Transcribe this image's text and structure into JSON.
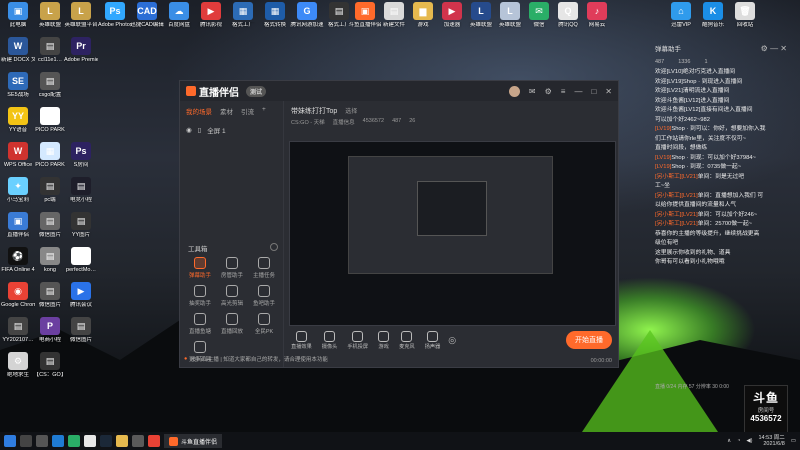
{
  "desktop_icons_left": [
    {
      "label": "此电脑",
      "color": "#3a8ee6",
      "glyph": "▣"
    },
    {
      "label": "英雄联盟",
      "color": "#c8a24a",
      "glyph": "L"
    },
    {
      "label": "新建 DOCX 文档",
      "color": "#2b579a",
      "glyph": "W"
    },
    {
      "label": "ccl11e1…",
      "color": "#444",
      "glyph": "▤"
    },
    {
      "label": "SE5战场",
      "color": "#2e6ab8",
      "glyph": "SE"
    },
    {
      "label": "csgo配置",
      "color": "#555",
      "glyph": "▤"
    },
    {
      "label": "YY语音",
      "color": "#f3c415",
      "glyph": "YY"
    },
    {
      "label": "PICO PARK",
      "color": "#ffffff",
      "glyph": "▦"
    },
    {
      "label": "WPS Office",
      "color": "#d0332f",
      "glyph": "W"
    },
    {
      "label": "PICO PARK",
      "color": "#d4e9ff",
      "glyph": "▦"
    },
    {
      "label": "小马宝莉",
      "color": "#6ad0ff",
      "glyph": "✦"
    },
    {
      "label": "pc端",
      "color": "#333",
      "glyph": "▤"
    },
    {
      "label": "直播伴侣",
      "color": "#3a7bd5",
      "glyph": "▣"
    },
    {
      "label": "微信图片",
      "color": "#666",
      "glyph": "▤"
    },
    {
      "label": "FIFA Online 4",
      "color": "#111",
      "glyph": "⚽"
    },
    {
      "label": "kong",
      "color": "#888",
      "glyph": "▤"
    },
    {
      "label": "Google Chrome",
      "color": "#e94235",
      "glyph": "◉"
    },
    {
      "label": "微信图片",
      "color": "#555",
      "glyph": "▤"
    },
    {
      "label": "YY202107…",
      "color": "#444",
      "glyph": "▤"
    },
    {
      "label": "电商小程",
      "color": "#6b3fa0",
      "glyph": "P"
    },
    {
      "label": "绝地求生",
      "color": "#d4d4d4",
      "glyph": "⚙"
    },
    {
      "label": "【CS：GO】",
      "color": "#333",
      "glyph": "▤"
    }
  ],
  "desktop_icons_col2": [
    {
      "label": "英雄联盟平台",
      "color": "#c8a24a",
      "glyph": "L"
    },
    {
      "label": "Adobe Premie…",
      "color": "#2d2261",
      "glyph": "Pr"
    },
    {
      "label": "S房间",
      "color": "#2d2261",
      "glyph": "Ps"
    },
    {
      "label": "电竞小程",
      "color": "#1e1e2a",
      "glyph": "▤"
    },
    {
      "label": "YY图片",
      "color": "#333",
      "glyph": "▤"
    },
    {
      "label": "perfectMo…",
      "color": "#fff",
      "glyph": "☰"
    },
    {
      "label": "腾讯会议",
      "color": "#2a72e8",
      "glyph": "▶"
    },
    {
      "label": "微信图片",
      "color": "#444",
      "glyph": "▤"
    }
  ],
  "desktop_icons_top": [
    {
      "label": "Adobe Photosho…",
      "color": "#31a8ff",
      "glyph": "Ps"
    },
    {
      "label": "迅捷CAD编辑",
      "color": "#2c6ed5",
      "glyph": "CAD"
    },
    {
      "label": "百度网盘",
      "color": "#3a8ee6",
      "glyph": "☁"
    },
    {
      "label": "腾讯影视",
      "color": "#e03c3c",
      "glyph": "▶"
    },
    {
      "label": "格式工厂",
      "color": "#2c6bb5",
      "glyph": "▦"
    },
    {
      "label": "格式转换",
      "color": "#1e5ca8",
      "glyph": "▦"
    },
    {
      "label": "腾讯网游加速",
      "color": "#3d8af7",
      "glyph": "G"
    },
    {
      "label": "格式工厂",
      "color": "#333",
      "glyph": "▤"
    },
    {
      "label": "斗鱼直播伴侣",
      "color": "#ff6a2b",
      "glyph": "▣"
    },
    {
      "label": "新建文件",
      "color": "#d9d9d9",
      "glyph": "▤"
    },
    {
      "label": "游戏",
      "color": "#e6b94e",
      "glyph": "▆"
    },
    {
      "label": "加速器",
      "color": "#d1344c",
      "glyph": "▶"
    },
    {
      "label": "英雄联盟",
      "color": "#264b8c",
      "glyph": "L"
    },
    {
      "label": "英雄联盟",
      "color": "#b6c4d8",
      "glyph": "L"
    },
    {
      "label": "微信",
      "color": "#2aae67",
      "glyph": "✉"
    },
    {
      "label": "腾讯QQ",
      "color": "#e6e6e6",
      "glyph": "Q"
    },
    {
      "label": "网易云",
      "color": "#e03c5a",
      "glyph": "♪"
    }
  ],
  "desktop_icons_topright": [
    {
      "label": "迅雷VIP",
      "color": "#2f9bec",
      "glyph": "⌂"
    },
    {
      "label": "酷狗音乐",
      "color": "#1b8ee6",
      "glyph": "K"
    },
    {
      "label": "回收站",
      "color": "#ddd",
      "glyph": "🗑"
    }
  ],
  "window": {
    "app_name": "直播伴侣",
    "version_badge": "测试",
    "tabs": [
      "我的场景",
      "素材",
      "引流"
    ],
    "scene_name": "全屏 1",
    "tools_title": "工具箱",
    "tools": [
      {
        "label": "弹幕助手",
        "hot": true
      },
      {
        "label": "房管助手",
        "hot": false
      },
      {
        "label": "主播任务",
        "hot": false
      },
      {
        "label": "抽奖助手",
        "hot": false
      },
      {
        "label": "高光剪辑",
        "hot": false
      },
      {
        "label": "鱼吧助手",
        "hot": false
      },
      {
        "label": "直播鱼塘",
        "hot": false
      },
      {
        "label": "直播回放",
        "hot": false
      },
      {
        "label": "全民PK",
        "hot": false
      },
      {
        "label": "更多工具",
        "hot": false
      }
    ],
    "notice": "支持私主播 | 知道大家都自己的转发，请合理使用本功能",
    "stream_title": "带妹练打打Top",
    "stream_tag": "选择",
    "meta": [
      "CS:GO - 天梯",
      "直播信息",
      "4536572",
      "487",
      "26"
    ],
    "bottom_tools": [
      "直播效果",
      "摄像头",
      "手机投屏",
      "游戏",
      "麦克风",
      "扬声器"
    ],
    "start_button": "开始直播",
    "timer": "00:00:00"
  },
  "chat": {
    "title": "弹幕助手",
    "stats": [
      "487",
      "1336",
      "1"
    ],
    "lines": [
      {
        "user": "",
        "text": "欢迎[LV10]绝对巧克进入直播间"
      },
      {
        "user": "",
        "text": "欢迎[LV19]Shop · 到现进入直播间"
      },
      {
        "user": "",
        "text": "欢迎[LV21]清明流进入直播间"
      },
      {
        "user": "",
        "text": "欢迎斗鱼酱[LV12]进入直播间"
      },
      {
        "user": "",
        "text": "欢迎斗鱼酱[LV12]直接有间进入直播间"
      },
      {
        "user": "",
        "text": "可以加个好2462~982"
      },
      {
        "user": "[LV19]",
        "text": "Shop · 到可以：你好，想要加你入我"
      },
      {
        "user": "",
        "text": "们工作站请你rle里，关注度不仅可~"
      },
      {
        "user": "",
        "text": "直播时间段，想做练"
      },
      {
        "user": "[LV19]",
        "text": "Shop · 到现：可以加个好37984~"
      },
      {
        "user": "[LV19]",
        "text": "Shop · 到现：0735做一起~"
      },
      {
        "user": "[另小斯工][LV21]",
        "text": "单间：到是无过吧"
      },
      {
        "user": "",
        "text": "工~坐"
      },
      {
        "user": "[另小斯工][LV21]",
        "text": "单间：直播想加入我们 可"
      },
      {
        "user": "",
        "text": "以给你提供直播间的流量和人气"
      },
      {
        "user": "[另小斯工][LV21]",
        "text": "单间：可以加个好246~"
      },
      {
        "user": "[另小斯工][LV21]",
        "text": "单间：25700做一起~"
      },
      {
        "user": "",
        "text": "恭喜你的主播的等级提升，继续挑战更高"
      },
      {
        "user": "",
        "text": "级位有吧"
      },
      {
        "user": "",
        "text": "这里展示你收到的礼物、道具"
      },
      {
        "user": "",
        "text": "你哥有可以看到小礼物哦哦"
      }
    ],
    "footer": "直播 0/24 内存 57 分辨率  30  0:00"
  },
  "room_badge": {
    "brand": "斗鱼",
    "label": "房间号",
    "number": "4536572"
  },
  "taskbar": {
    "active_app": "斗鱼直播伴侣",
    "clock_time": "14:53",
    "clock_date": "2021/6/8",
    "weekday": "周二"
  }
}
